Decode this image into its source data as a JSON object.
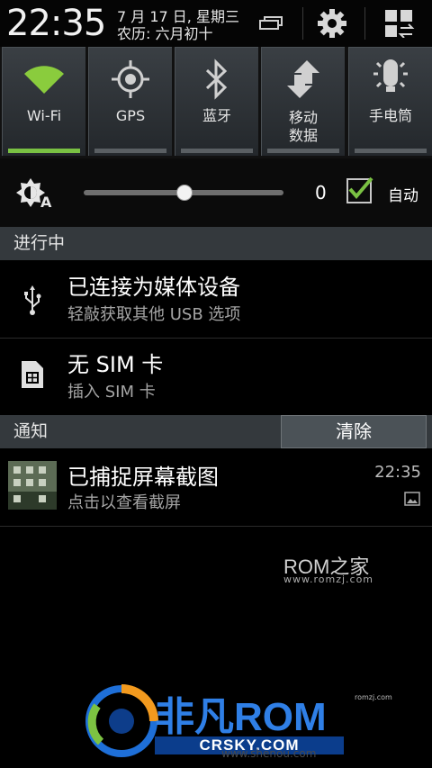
{
  "status": {
    "time": "22:35",
    "date_line1": "7 月 17 日, 星期三",
    "date_line2": "农历: 六月初十"
  },
  "header_icons": [
    "recent-apps-icon",
    "settings-gear-icon",
    "grid-toggle-icon"
  ],
  "quick_settings": [
    {
      "label": "Wi-Fi",
      "icon": "wifi-icon",
      "active": true
    },
    {
      "label": "GPS",
      "icon": "gps-icon",
      "active": false
    },
    {
      "label": "蓝牙",
      "icon": "bluetooth-icon",
      "active": false
    },
    {
      "label1": "移动",
      "label2": "数据",
      "icon": "mobile-data-icon",
      "active": false
    },
    {
      "label": "手电筒",
      "icon": "flashlight-icon",
      "active": false
    }
  ],
  "brightness": {
    "icon": "auto-brightness-icon",
    "level_fraction": 0.5,
    "value": "0",
    "auto_label": "自动",
    "auto_checked": true
  },
  "ongoing": {
    "header": "进行中",
    "items": [
      {
        "title": "已连接为媒体设备",
        "subtitle": "轻敲获取其他 USB 选项",
        "icon": "usb-icon"
      },
      {
        "title": "无 SIM 卡",
        "subtitle": "插入 SIM 卡",
        "icon": "sim-card-icon"
      }
    ]
  },
  "notifications": {
    "header": "通知",
    "clear_label": "清除",
    "items": [
      {
        "title": "已捕捉屏幕截图",
        "subtitle": "点击以查看截屏",
        "time": "22:35",
        "icon": "image-icon"
      }
    ]
  },
  "watermarks": {
    "romzj_title": "ROM之家",
    "romzj_url": "www.romzj.com",
    "small_url": "romzj.com",
    "crsky_name": "非凡ROM",
    "crsky_sub": "CRSKY.COM",
    "bottom_url": "www.shenou.com"
  },
  "colors": {
    "accent_green": "#7ac143",
    "section_bg": "#34393d",
    "tile_bg": "#2e3337"
  }
}
